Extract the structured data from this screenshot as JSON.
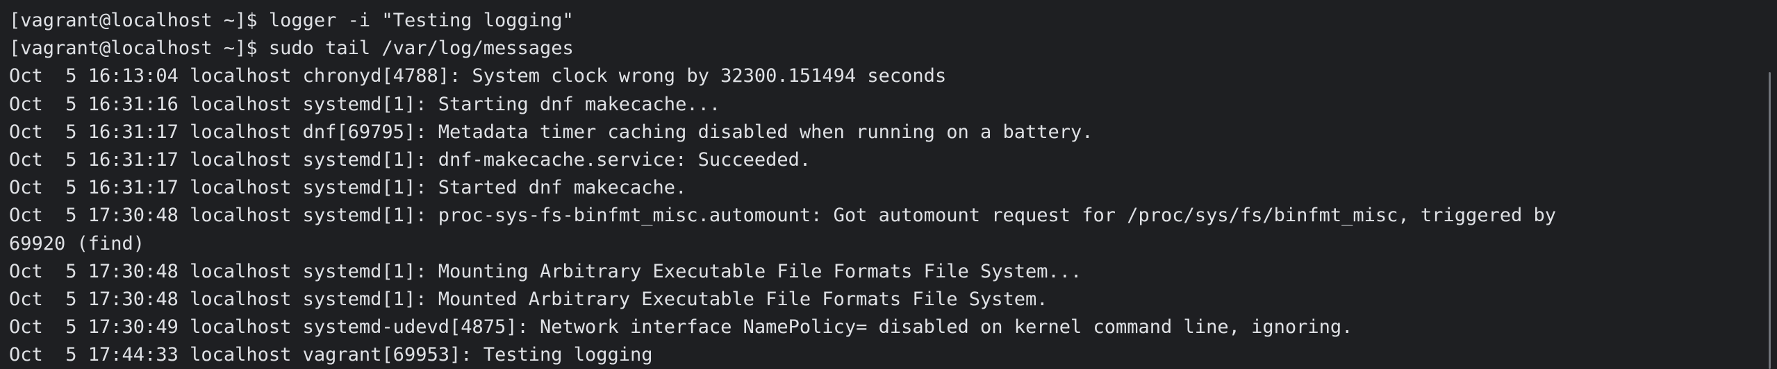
{
  "terminal": {
    "lines": [
      "[vagrant@localhost ~]$ logger -i \"Testing logging\"",
      "[vagrant@localhost ~]$ sudo tail /var/log/messages",
      "Oct  5 16:13:04 localhost chronyd[4788]: System clock wrong by 32300.151494 seconds",
      "Oct  5 16:31:16 localhost systemd[1]: Starting dnf makecache...",
      "Oct  5 16:31:17 localhost dnf[69795]: Metadata timer caching disabled when running on a battery.",
      "Oct  5 16:31:17 localhost systemd[1]: dnf-makecache.service: Succeeded.",
      "Oct  5 16:31:17 localhost systemd[1]: Started dnf makecache.",
      "Oct  5 17:30:48 localhost systemd[1]: proc-sys-fs-binfmt_misc.automount: Got automount request for /proc/sys/fs/binfmt_misc, triggered by",
      "69920 (find)",
      "Oct  5 17:30:48 localhost systemd[1]: Mounting Arbitrary Executable File Formats File System...",
      "Oct  5 17:30:48 localhost systemd[1]: Mounted Arbitrary Executable File Formats File System.",
      "Oct  5 17:30:49 localhost systemd-udevd[4875]: Network interface NamePolicy= disabled on kernel command line, ignoring.",
      "Oct  5 17:44:33 localhost vagrant[69953]: Testing logging"
    ]
  },
  "colors": {
    "background": "#1e1f22",
    "text": "#dfe1e5",
    "scrollbar": "#6f737a"
  }
}
